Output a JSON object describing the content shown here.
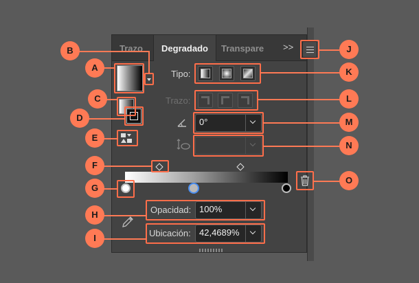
{
  "tabs": [
    {
      "label": "Trazo"
    },
    {
      "label": "Degradado"
    },
    {
      "label": "Transpare"
    }
  ],
  "tab_overflow": ">>",
  "labels": {
    "tipo": "Tipo:",
    "trazo": "Trazo:",
    "opacidad": "Opacidad:",
    "ubicacion": "Ubicación:"
  },
  "fields": {
    "angle": "0°",
    "aspect_ratio": "",
    "opacity": "100%",
    "location": "42,4689%"
  },
  "callouts": [
    "A",
    "B",
    "C",
    "D",
    "E",
    "F",
    "G",
    "H",
    "I",
    "J",
    "K",
    "L",
    "M",
    "N",
    "O"
  ],
  "colors": {
    "callout": "#ff7a55",
    "panel_bg": "#434343",
    "selected_stop": "#4a8ef0"
  },
  "icons": {
    "tab_menu": "hamburger-menu-icon",
    "eyedropper": "eyedropper-icon",
    "delete_stop": "trash-icon",
    "angle": "angle-icon",
    "aspect": "aspect-ratio-icon"
  }
}
